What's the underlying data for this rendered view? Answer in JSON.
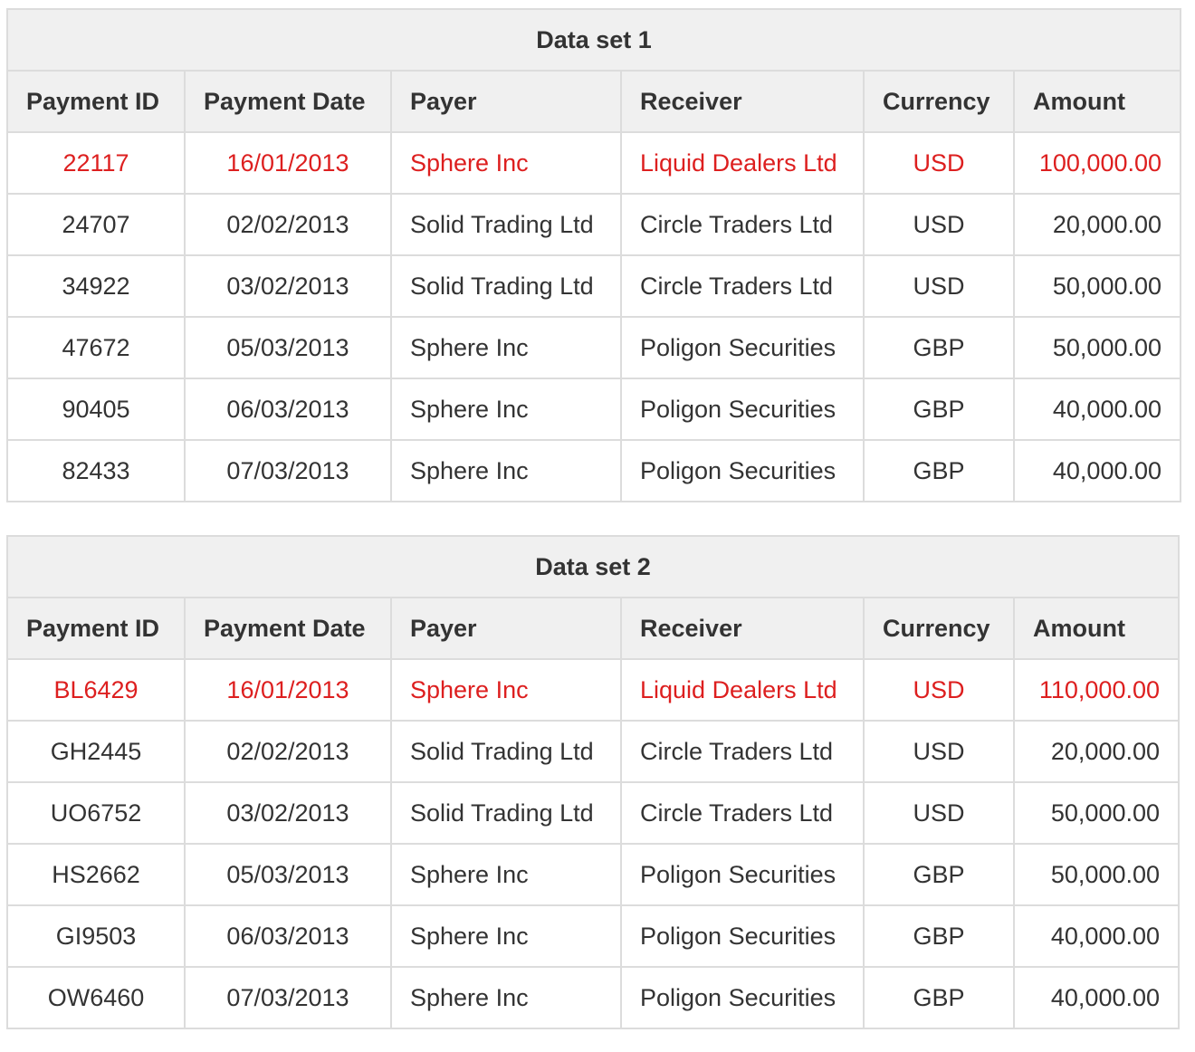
{
  "colors": {
    "highlight": "#dd1f1f",
    "header_bg": "#f0f0f0",
    "border": "#dcdcdc",
    "text": "#333333"
  },
  "tables": [
    {
      "title": "Data set 1",
      "headers": [
        "Payment ID",
        "Payment Date",
        "Payer",
        "Receiver",
        "Currency",
        "Amount"
      ],
      "rows": [
        {
          "highlight": true,
          "cells": [
            "22117",
            "16/01/2013",
            "Sphere Inc",
            "Liquid Dealers Ltd",
            "USD",
            "100,000.00"
          ]
        },
        {
          "highlight": false,
          "cells": [
            "24707",
            "02/02/2013",
            "Solid Trading Ltd",
            "Circle Traders Ltd",
            "USD",
            "20,000.00"
          ]
        },
        {
          "highlight": false,
          "cells": [
            "34922",
            "03/02/2013",
            "Solid Trading Ltd",
            "Circle Traders Ltd",
            "USD",
            "50,000.00"
          ]
        },
        {
          "highlight": false,
          "cells": [
            "47672",
            "05/03/2013",
            "Sphere Inc",
            "Poligon Securities",
            "GBP",
            "50,000.00"
          ]
        },
        {
          "highlight": false,
          "cells": [
            "90405",
            "06/03/2013",
            "Sphere Inc",
            "Poligon Securities",
            "GBP",
            "40,000.00"
          ]
        },
        {
          "highlight": false,
          "cells": [
            "82433",
            "07/03/2013",
            "Sphere Inc",
            "Poligon Securities",
            "GBP",
            "40,000.00"
          ]
        }
      ]
    },
    {
      "title": "Data set 2",
      "headers": [
        "Payment ID",
        "Payment Date",
        "Payer",
        "Receiver",
        "Currency",
        "Amount"
      ],
      "rows": [
        {
          "highlight": true,
          "cells": [
            "BL6429",
            "16/01/2013",
            "Sphere Inc",
            "Liquid Dealers Ltd",
            "USD",
            "110,000.00"
          ]
        },
        {
          "highlight": false,
          "cells": [
            "GH2445",
            "02/02/2013",
            "Solid Trading Ltd",
            "Circle Traders Ltd",
            "USD",
            "20,000.00"
          ]
        },
        {
          "highlight": false,
          "cells": [
            "UO6752",
            "03/02/2013",
            "Solid Trading Ltd",
            "Circle Traders Ltd",
            "USD",
            "50,000.00"
          ]
        },
        {
          "highlight": false,
          "cells": [
            "HS2662",
            "05/03/2013",
            "Sphere Inc",
            "Poligon Securities",
            "GBP",
            "50,000.00"
          ]
        },
        {
          "highlight": false,
          "cells": [
            "GI9503",
            "06/03/2013",
            "Sphere Inc",
            "Poligon Securities",
            "GBP",
            "40,000.00"
          ]
        },
        {
          "highlight": false,
          "cells": [
            "OW6460",
            "07/03/2013",
            "Sphere Inc",
            "Poligon Securities",
            "GBP",
            "40,000.00"
          ]
        }
      ]
    }
  ]
}
